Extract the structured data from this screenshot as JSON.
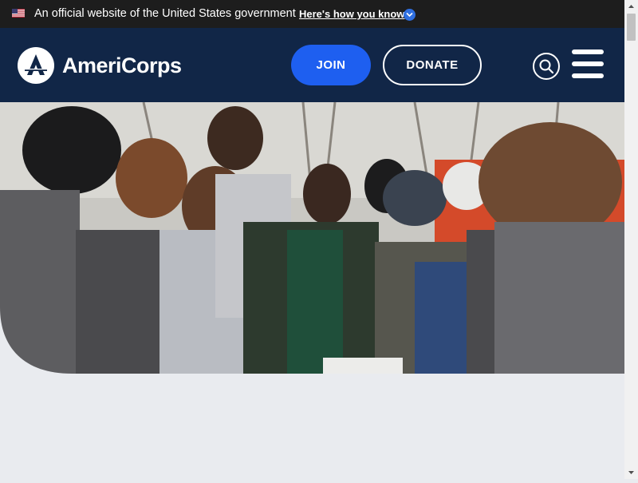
{
  "gov_banner": {
    "text": "An official website of the United States government",
    "link_text": "Here's how you know"
  },
  "header": {
    "logo_text": "AmeriCorps",
    "join_label": "JOIN",
    "donate_label": "DONATE",
    "search_icon": "search-icon",
    "menu_icon": "hamburger-menu-icon"
  },
  "hero": {
    "image": "group of AmeriCorps members gathered around a map outdoors"
  },
  "colors": {
    "banner_bg": "#1d1d1d",
    "header_bg": "#112647",
    "join_bg": "#1e5ff0",
    "page_bg": "#e9ebef"
  }
}
